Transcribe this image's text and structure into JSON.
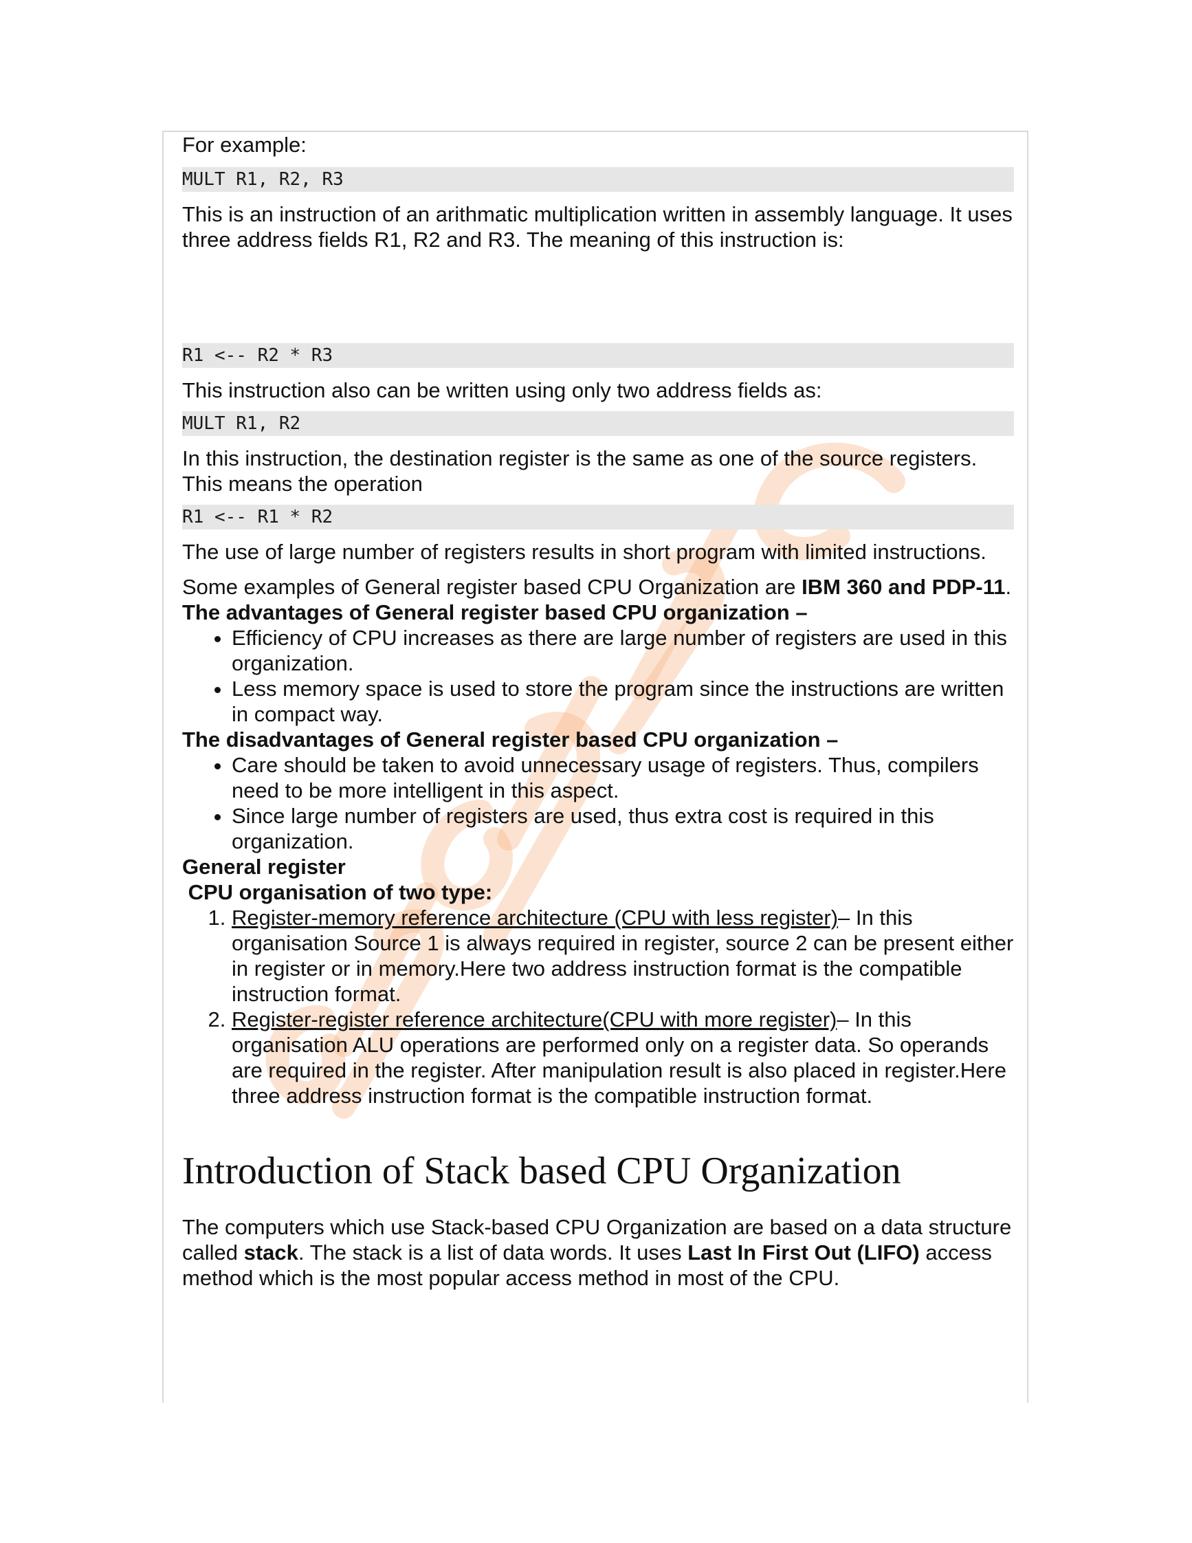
{
  "intro": "For example:",
  "code1": "MULT R1, R2, R3",
  "para1": "This is an instruction of an arithmatic multiplication written in assembly language. It uses three address fields R1, R2 and R3. The meaning of this instruction is:",
  "code2": "R1 <-- R2 * R3",
  "para2": "This instruction also can be written using only two address fields as:",
  "code3": "MULT R1, R2",
  "para3": "In this instruction, the destination register is the same as one of the source registers. This means the operation",
  "code4": "R1 <-- R1 * R2",
  "para4": "The use of large number of registers results in short program with limited instructions.",
  "para5": {
    "text": "Some examples of General register based CPU Organization are ",
    "bold": "IBM 360 and PDP-11",
    "end": "."
  },
  "advantages": {
    "heading": "The advantages of General register based CPU organization –",
    "items": [
      "Efficiency of CPU increases as there are large number of registers are used in this organization.",
      "Less memory space is used to store the program since the instructions are written in compact way."
    ]
  },
  "disadvantages": {
    "heading": "The disadvantages of General register based CPU organization –",
    "items": [
      "Care should be taken to avoid unnecessary usage of registers. Thus, compilers need to be more intelligent in this aspect.",
      "Since large number of registers are used, thus extra cost is required in this organization."
    ]
  },
  "types": {
    "heading1": "General register",
    "heading2": " CPU organisation of two type:",
    "items": [
      {
        "link": "Register-memory reference architecture (CPU with less register)",
        "text": "– In this organisation Source 1 is always required in register, source 2 can be present either in register or in memory.Here two address instruction format is the compatible instruction format."
      },
      {
        "link": "Register-register reference architecture(CPU with more register)",
        "text": "– In this organisation ALU operations are performed only on a register data. So operands are required in the register. After manipulation result is also placed in register.Here three address instruction format is the compatible instruction format."
      }
    ]
  },
  "section": {
    "title": "Introduction of Stack based CPU Organization",
    "p_a": "The computers which use Stack-based CPU Organization are based on a data structure called ",
    "b_a": "stack",
    "p_b": ". The stack is a list of data words. It uses ",
    "b_b": "Last In First Out (LIFO)",
    "p_c": " access method which is the most popular access method in most of the CPU."
  },
  "watermark": {
    "color": "#f6a56a"
  }
}
